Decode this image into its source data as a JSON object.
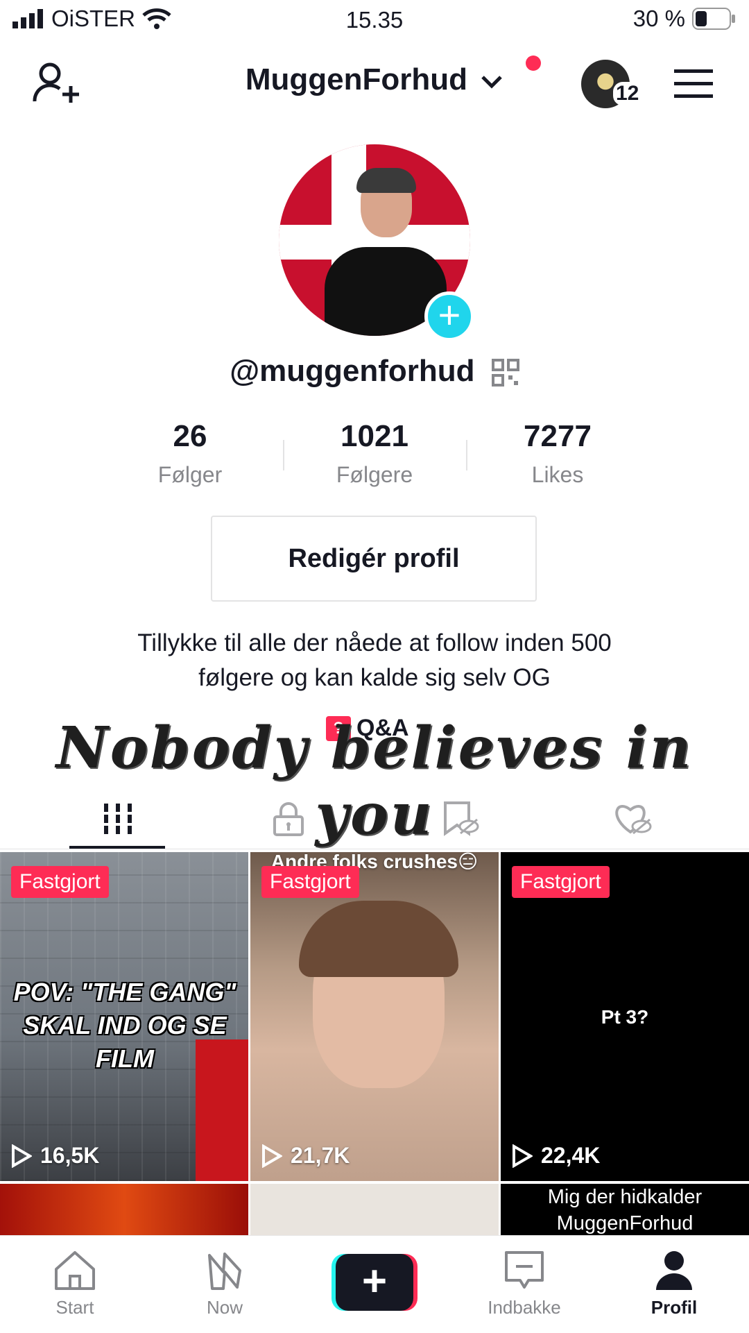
{
  "status_bar": {
    "carrier": "OiSTER",
    "time": "15.35",
    "battery": "30 %"
  },
  "header": {
    "username_title": "MuggenForhud",
    "inbox_badge_count": "12"
  },
  "profile": {
    "handle": "@muggenforhud",
    "stats": [
      {
        "value": "26",
        "label": "Følger"
      },
      {
        "value": "1021",
        "label": "Følgere"
      },
      {
        "value": "7277",
        "label": "Likes"
      }
    ],
    "edit_button": "Redigér profil",
    "bio_line1": "Tillykke til alle der nåede at follow inden 500",
    "bio_line2": "følgere og kan kalde sig selv OG",
    "qa_label": "Q&A"
  },
  "overlay_text": "Nobody believes in you",
  "tabs": [
    {
      "icon": "grid-icon",
      "active": true
    },
    {
      "icon": "lock-icon",
      "active": false
    },
    {
      "icon": "hidden-bookmark-icon",
      "active": false
    },
    {
      "icon": "hidden-heart-icon",
      "active": false
    }
  ],
  "videos": [
    {
      "pinned": "Fastgjort",
      "caption": "Pov: \"The gang\" skal ind og se film",
      "views": "16,5K"
    },
    {
      "pinned": "Fastgjort",
      "caption": "Andre folks crushes😑",
      "views": "21,7K"
    },
    {
      "pinned": "Fastgjort",
      "caption": "Pt 3?",
      "views": "22,4K"
    },
    {
      "pinned": "",
      "caption": "",
      "views": ""
    },
    {
      "pinned": "",
      "caption": "",
      "views": ""
    },
    {
      "pinned": "",
      "caption": "Mig der hidkalder MuggenForhud",
      "views": ""
    }
  ],
  "bottom_nav": [
    {
      "label": "Start",
      "icon": "home-icon"
    },
    {
      "label": "Now",
      "icon": "now-icon"
    },
    {
      "label": "",
      "icon": "create-plus-icon"
    },
    {
      "label": "Indbakke",
      "icon": "inbox-icon"
    },
    {
      "label": "Profil",
      "icon": "profile-icon"
    }
  ],
  "colors": {
    "accent": "#fe2c55",
    "teal": "#20d5ec",
    "text": "#161823",
    "muted": "#86878b"
  }
}
